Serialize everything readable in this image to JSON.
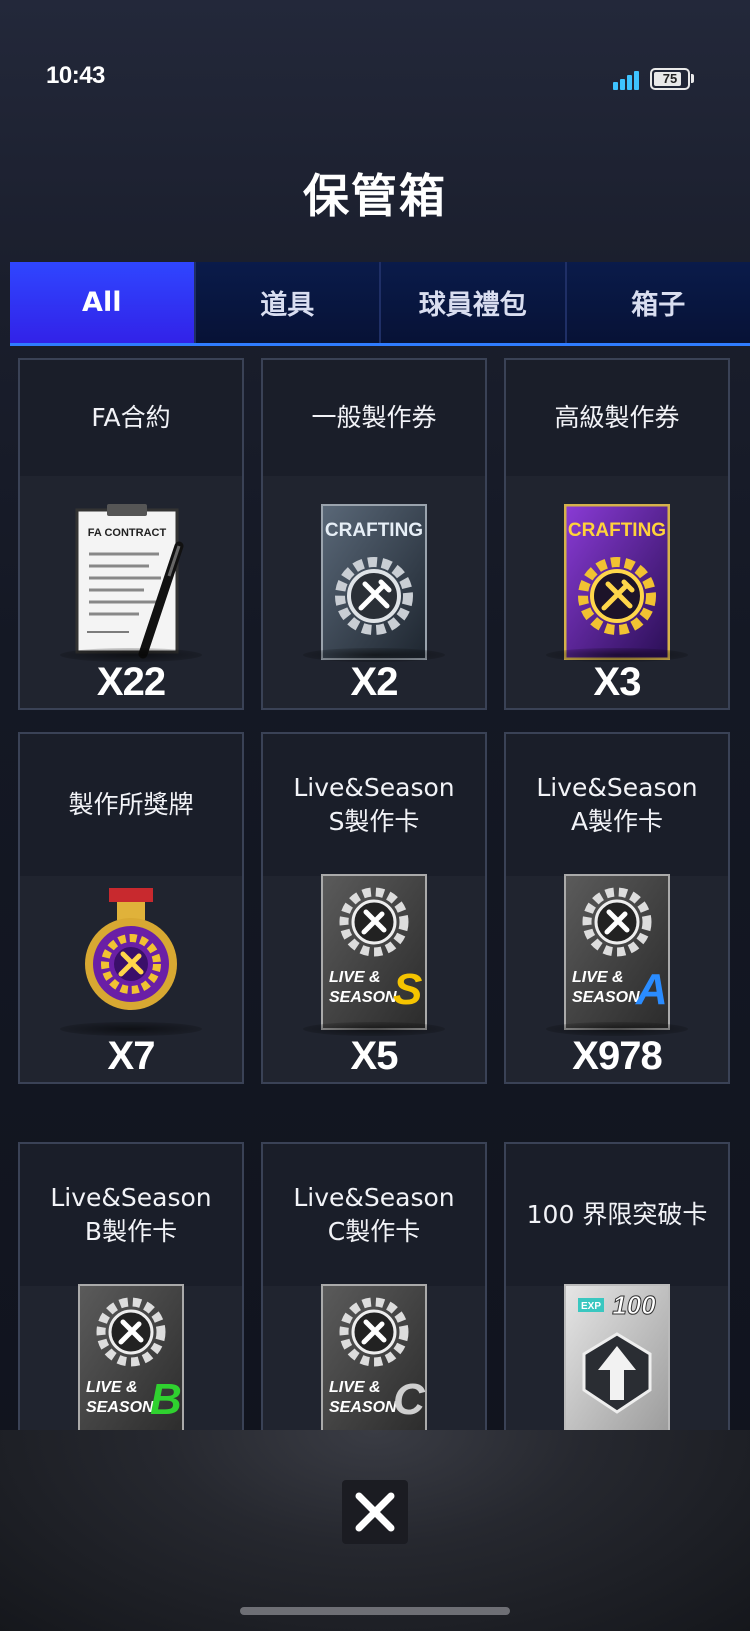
{
  "status_bar": {
    "time": "10:43",
    "battery": "75"
  },
  "page": {
    "title": "保管箱"
  },
  "tabs": [
    {
      "label": "All",
      "active": true
    },
    {
      "label": "道具",
      "active": false
    },
    {
      "label": "球員禮包",
      "active": false
    },
    {
      "label": "箱子",
      "active": false
    }
  ],
  "items": [
    {
      "name": "FA合約",
      "count": "X22",
      "icon": "fa-contract-icon",
      "icon_text": "FA CONTRACT"
    },
    {
      "name": "一般製作券",
      "count": "X2",
      "icon": "crafting-ticket-icon",
      "icon_text": "CRAFTING"
    },
    {
      "name": "高級製作券",
      "count": "X3",
      "icon": "premium-crafting-ticket-icon",
      "icon_text": "CRAFTING"
    },
    {
      "name": "製作所獎牌",
      "count": "X7",
      "icon": "crafting-medal-icon"
    },
    {
      "name": "Live&Season\nS製作卡",
      "count": "X5",
      "icon": "live-season-s-card-icon",
      "icon_text": "LIVE & SEASON",
      "grade": "S"
    },
    {
      "name": "Live&Season\nA製作卡",
      "count": "X978",
      "icon": "live-season-a-card-icon",
      "icon_text": "LIVE & SEASON",
      "grade": "A"
    },
    {
      "name": "Live&Season\nB製作卡",
      "count": "",
      "icon": "live-season-b-card-icon",
      "icon_text": "LIVE & SEASON",
      "grade": "B"
    },
    {
      "name": "Live&Season\nC製作卡",
      "count": "",
      "icon": "live-season-c-card-icon",
      "icon_text": "LIVE & SEASON",
      "grade": "C"
    },
    {
      "name": "100 界限突破卡",
      "count": "",
      "icon": "exp-100-card-icon",
      "icon_text": "EXP",
      "icon_value": "100"
    }
  ],
  "colors": {
    "tab_active": "#3222e8",
    "tab_bg": "#0a1b4a",
    "accent_line": "#2f7cff",
    "card_bg": "#20242f",
    "grade_s": "#f5c400",
    "grade_a": "#2a8cff",
    "grade_b": "#2fd12f",
    "grade_c": "#cfcfcf"
  },
  "close_button": {
    "icon": "close-icon"
  }
}
